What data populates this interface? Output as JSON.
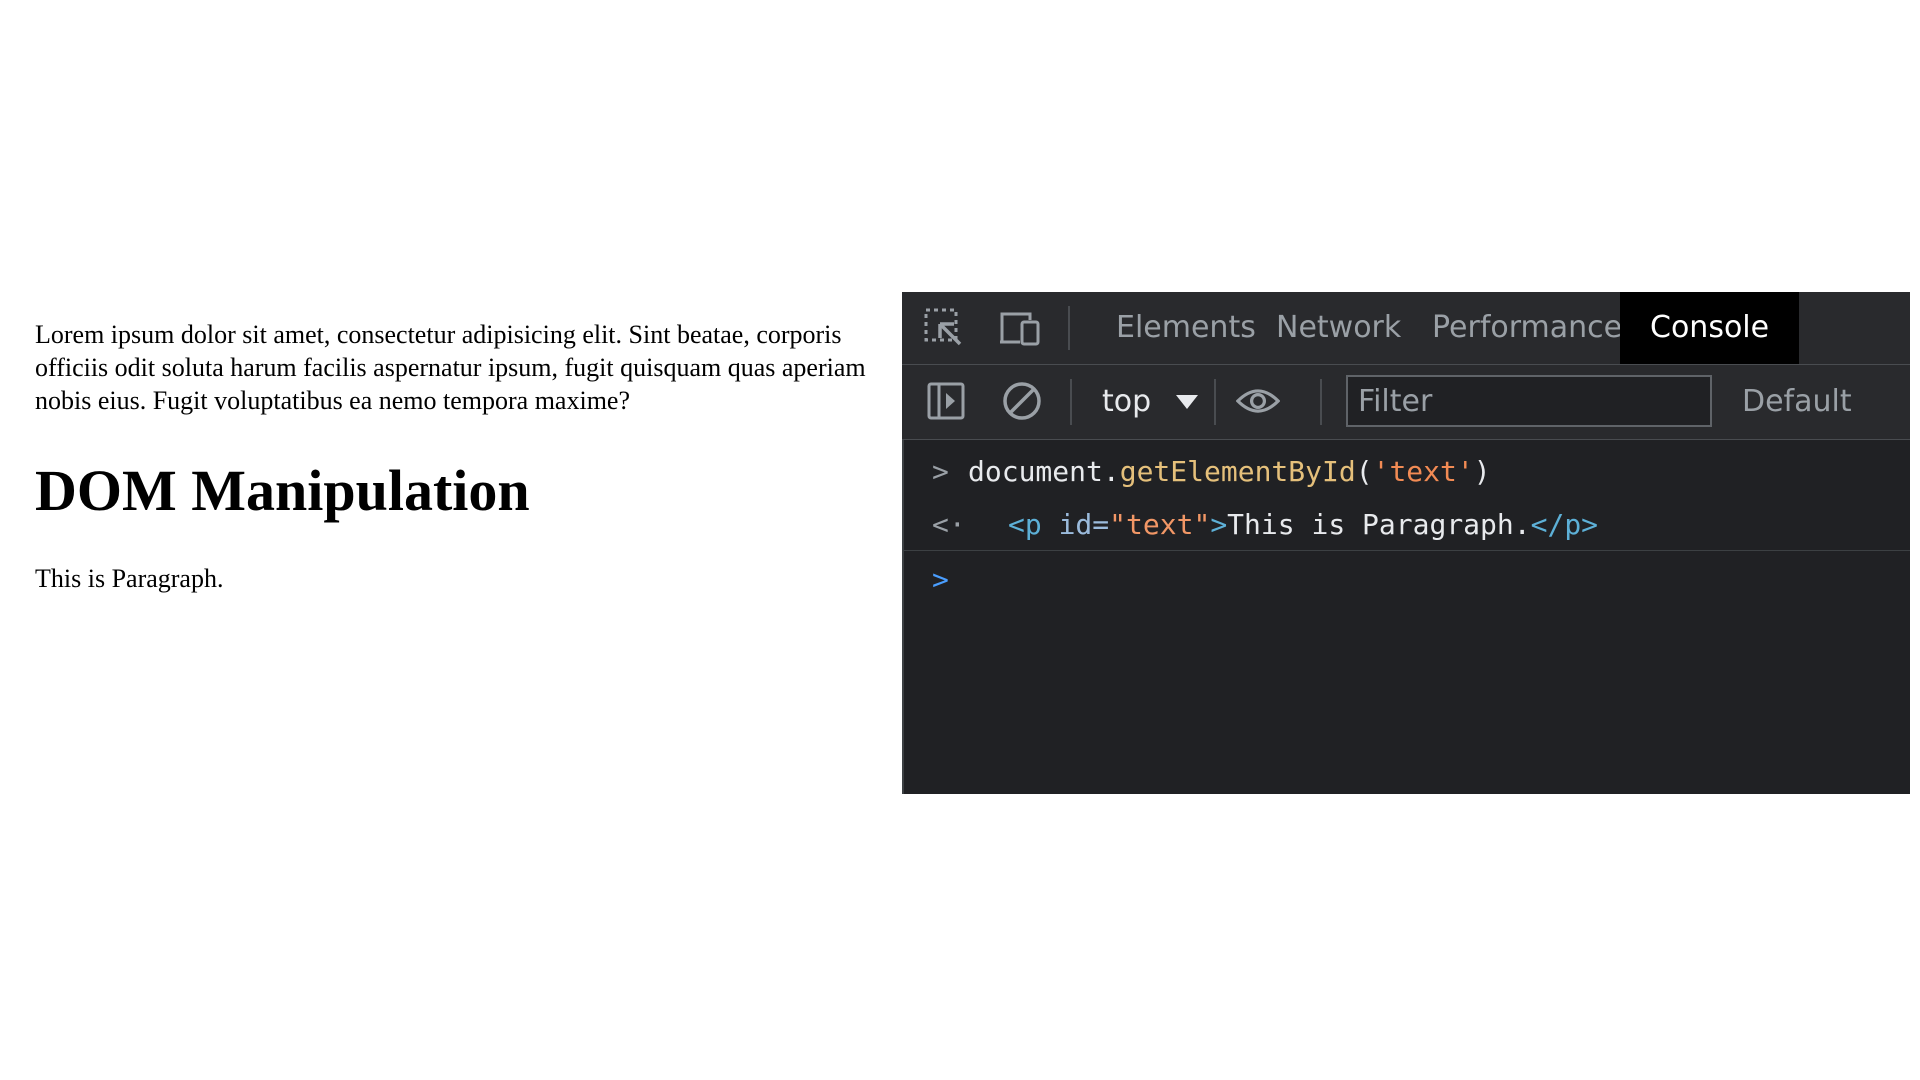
{
  "page": {
    "intro_text": "Lorem ipsum dolor sit amet, consectetur adipisicing elit. Sint beatae, corporis officiis odit soluta harum facilis aspernatur ipsum, fugit quisquam quas aperiam nobis eius. Fugit voluptatibus ea nemo tempora maxime?",
    "heading": "DOM Manipulation",
    "paragraph": "This is Paragraph."
  },
  "devtools": {
    "tabs": [
      {
        "label": "Elements",
        "active": false
      },
      {
        "label": "Network",
        "active": false
      },
      {
        "label": "Performance",
        "active": false
      },
      {
        "label": "Console",
        "active": true
      }
    ],
    "toolbar": {
      "context": "top",
      "filter_placeholder": "Filter",
      "levels_label": "Default"
    },
    "console": {
      "input": {
        "obj": "document.",
        "method": "getElementById",
        "open": "(",
        "arg": "'text'",
        "close": ")"
      },
      "output": {
        "open_tag": "<p",
        "attr_name": " id=",
        "attr_value": "\"text\"",
        "tag_end": ">",
        "text": "This is Paragraph.",
        "close_tag": "</p>"
      }
    },
    "colors": {
      "background": "#202124",
      "toolbar": "#292a2d",
      "active_tab": "#000000"
    },
    "icons": [
      "inspect-element-icon",
      "device-toolbar-icon",
      "sidebar-toggle-icon",
      "clear-console-icon",
      "context-dropdown-icon",
      "live-expression-eye-icon",
      "input-prompt-icon",
      "result-arrow-icon"
    ]
  }
}
